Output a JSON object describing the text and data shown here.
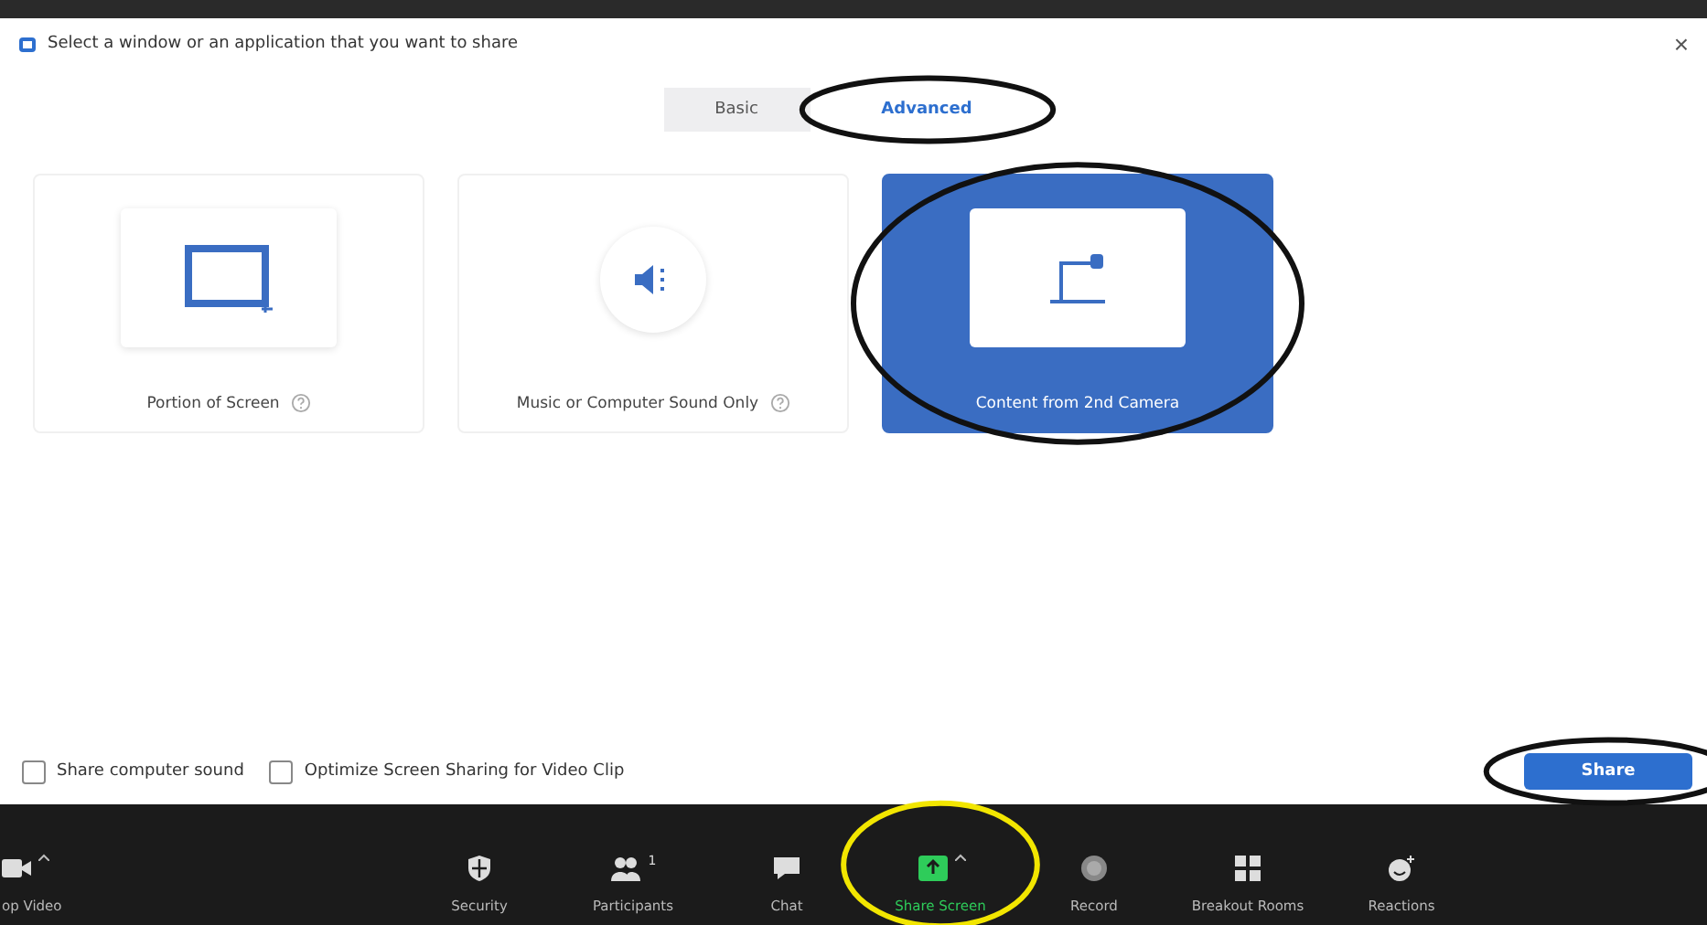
{
  "dialog": {
    "title": "Select a window or an application that you want to share",
    "close": "×"
  },
  "tabs": [
    {
      "label": "Basic",
      "selected": false,
      "circled": false
    },
    {
      "label": "Advanced",
      "selected": true,
      "circled": true
    }
  ],
  "options": [
    {
      "kind": "portion",
      "label": "Portion of Screen",
      "selected": false,
      "help": true,
      "circled": false
    },
    {
      "kind": "sound",
      "label": "Music or Computer Sound Only",
      "selected": false,
      "help": true,
      "circled": false
    },
    {
      "kind": "camera",
      "label": "Content from 2nd Camera",
      "selected": true,
      "help": false,
      "circled": true
    }
  ],
  "checkboxes": [
    {
      "label": "Share computer sound",
      "checked": false
    },
    {
      "label": "Optimize Screen Sharing for Video Clip",
      "checked": false
    }
  ],
  "share_button": {
    "label": "Share",
    "circled": true
  },
  "toolbar": [
    {
      "kind": "video",
      "label": "op Video",
      "menu": true,
      "active": false,
      "circled": false
    },
    {
      "kind": "security",
      "label": "Security",
      "menu": false,
      "active": false,
      "circled": false
    },
    {
      "kind": "participants",
      "label": "Participants",
      "count": "1",
      "menu": false,
      "active": false,
      "circled": false
    },
    {
      "kind": "chat",
      "label": "Chat",
      "menu": false,
      "active": false,
      "circled": false
    },
    {
      "kind": "share",
      "label": "Share Screen",
      "menu": true,
      "active": true,
      "circled": true
    },
    {
      "kind": "record",
      "label": "Record",
      "menu": false,
      "active": false,
      "circled": false
    },
    {
      "kind": "breakout",
      "label": "Breakout Rooms",
      "menu": false,
      "active": false,
      "circled": false
    },
    {
      "kind": "reactions",
      "label": "Reactions",
      "menu": false,
      "active": false,
      "circled": false
    }
  ]
}
